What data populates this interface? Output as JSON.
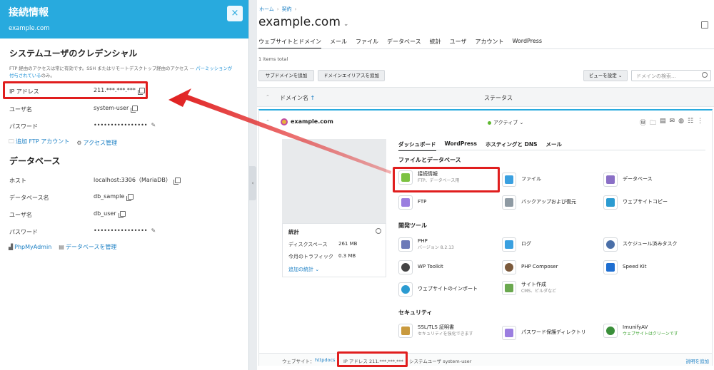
{
  "left_panel": {
    "title": "接続情報",
    "subtitle": "example.com",
    "close_icon": "×",
    "cred_heading": "システムユーザのクレデンシャル",
    "note_prefix": "FTP 経由のアクセスは常に有効です。SSH またはリモートデスクトップ経由のアクセス — ",
    "note_link": "パーミッションが付与されている",
    "note_suffix": "のみ。",
    "ip_label": "IP アドレス",
    "ip_value": "211.***.***.***",
    "user_label": "ユーザ名",
    "user_value": "system-user",
    "pass_label": "パスワード",
    "pass_value": "••••••••••••••••",
    "add_ftp": "追加 FTP アカウント",
    "access_mgmt": "アクセス管理",
    "db_heading": "データベース",
    "host_label": "ホスト",
    "host_value": "localhost:3306（MariaDB）",
    "dbname_label": "データベース名",
    "dbname_value": "db_sample",
    "dbuser_label": "ユーザ名",
    "dbuser_value": "db_user",
    "dbpass_label": "パスワード",
    "dbpass_value": "••••••••••••••••",
    "phpmyadmin": "PhpMyAdmin",
    "db_manage": "データベースを管理"
  },
  "main": {
    "breadcrumb": [
      "ホーム",
      "契約"
    ],
    "title": "example.com",
    "tabs": [
      "ウェブサイトとドメイン",
      "メール",
      "ファイル",
      "データベース",
      "統計",
      "ユーザ",
      "アカウント",
      "WordPress"
    ],
    "items_total": "1 items total",
    "btn_add_subdomain": "サブドメインを追加",
    "btn_add_alias": "ドメインエイリアスを追加",
    "btn_view": "ビューを設定",
    "search_placeholder": "ドメインの検索...",
    "col_domain": "ドメイン名",
    "col_domain_sort": "↑",
    "col_status": "ステータス",
    "domain": {
      "name": "example.com",
      "status": "アクティブ",
      "subtabs": [
        "ダッシュボード",
        "WordPress",
        "ホスティングと DNS",
        "メール"
      ]
    },
    "stats": {
      "heading": "統計",
      "disk_label": "ディスクスペース",
      "disk_value": "261 MB",
      "traffic_label": "今月のトラフィック",
      "traffic_value": "0.3 MB",
      "more": "追加の統計"
    },
    "sections": {
      "files": "ファイルとデータベース",
      "dev": "開発ツール",
      "security": "セキュリティ"
    },
    "tools": {
      "conn": {
        "label": "接続情報",
        "sub": "FTP、データベース用"
      },
      "file": {
        "label": "ファイル"
      },
      "db": {
        "label": "データベース"
      },
      "ftp": {
        "label": "FTP"
      },
      "backup": {
        "label": "バックアップおよび復元"
      },
      "copy": {
        "label": "ウェブサイトコピー"
      },
      "php": {
        "label": "PHP",
        "sub": "バージョン 8.2.13"
      },
      "log": {
        "label": "ログ"
      },
      "sched": {
        "label": "スケジュール済みタスク"
      },
      "wpt": {
        "label": "WP Toolkit"
      },
      "composer": {
        "label": "PHP Composer"
      },
      "speed": {
        "label": "Speed Kit"
      },
      "import": {
        "label": "ウェブサイトのインポート"
      },
      "builder": {
        "label": "サイト作成",
        "sub": "CMS、ビルダなど"
      },
      "ssl": {
        "label": "SSL/TLS 証明書",
        "sub": "セキュリティを強化できます"
      },
      "pwdir": {
        "label": "パスワード保護ディレクトリ"
      },
      "imunify": {
        "label": "ImunifyAV",
        "sub": "ウェブサイトはクリーンです"
      }
    },
    "footer": {
      "website_label": "ウェブサイト：",
      "website_link": "httpdocs",
      "ip_text": "IP アドレス 211.***.***.***",
      "sysuser_text": "システムユーザ system-user",
      "desc_link": "説明を追加"
    }
  },
  "colors": {
    "accent": "#28aade",
    "highlight": "#e01e1e",
    "active": "#5eb82f"
  }
}
